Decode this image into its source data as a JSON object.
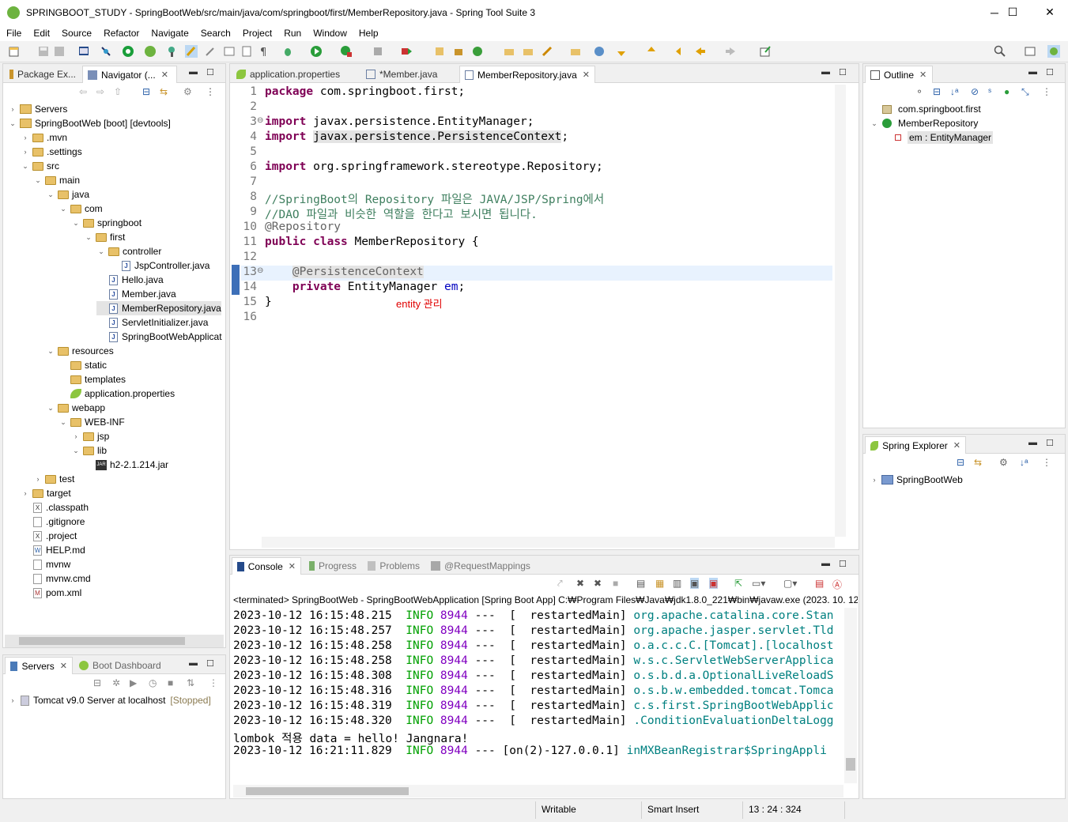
{
  "window": {
    "title": "SPRINGBOOT_STUDY - SpringBootWeb/src/main/java/com/springboot/first/MemberRepository.java - Spring Tool Suite 3",
    "controls": [
      "─",
      "☐",
      "✕"
    ]
  },
  "menu": [
    "File",
    "Edit",
    "Source",
    "Refactor",
    "Navigate",
    "Search",
    "Project",
    "Run",
    "Window",
    "Help"
  ],
  "left_panel": {
    "tabs": [
      {
        "label": "Package Ex..."
      },
      {
        "label": "Navigator (..."
      }
    ],
    "tree": [
      {
        "label": "Servers",
        "indent": 0,
        "twisty": "›",
        "icon": "project"
      },
      {
        "label": "SpringBootWeb [boot] [devtools]",
        "indent": 0,
        "twisty": "⌄",
        "icon": "project"
      },
      {
        "label": ".mvn",
        "indent": 1,
        "twisty": "›",
        "icon": "folder"
      },
      {
        "label": ".settings",
        "indent": 1,
        "twisty": "›",
        "icon": "folder"
      },
      {
        "label": "src",
        "indent": 1,
        "twisty": "⌄",
        "icon": "folder"
      },
      {
        "label": "main",
        "indent": 2,
        "twisty": "⌄",
        "icon": "folder"
      },
      {
        "label": "java",
        "indent": 3,
        "twisty": "⌄",
        "icon": "folder"
      },
      {
        "label": "com",
        "indent": 4,
        "twisty": "⌄",
        "icon": "folder"
      },
      {
        "label": "springboot",
        "indent": 5,
        "twisty": "⌄",
        "icon": "folder"
      },
      {
        "label": "first",
        "indent": 6,
        "twisty": "⌄",
        "icon": "folder"
      },
      {
        "label": "controller",
        "indent": 7,
        "twisty": "⌄",
        "icon": "folder"
      },
      {
        "label": "JspController.java",
        "indent": 8,
        "twisty": "",
        "icon": "java"
      },
      {
        "label": "Hello.java",
        "indent": 7,
        "twisty": "",
        "icon": "java"
      },
      {
        "label": "Member.java",
        "indent": 7,
        "twisty": "",
        "icon": "java"
      },
      {
        "label": "MemberRepository.java",
        "indent": 7,
        "twisty": "",
        "icon": "java",
        "selected": true
      },
      {
        "label": "ServletInitializer.java",
        "indent": 7,
        "twisty": "",
        "icon": "java"
      },
      {
        "label": "SpringBootWebApplicat",
        "indent": 7,
        "twisty": "",
        "icon": "java"
      },
      {
        "label": "resources",
        "indent": 3,
        "twisty": "⌄",
        "icon": "folder"
      },
      {
        "label": "static",
        "indent": 4,
        "twisty": "",
        "icon": "folder"
      },
      {
        "label": "templates",
        "indent": 4,
        "twisty": "",
        "icon": "folder"
      },
      {
        "label": "application.properties",
        "indent": 4,
        "twisty": "",
        "icon": "leaf"
      },
      {
        "label": "webapp",
        "indent": 3,
        "twisty": "⌄",
        "icon": "folder"
      },
      {
        "label": "WEB-INF",
        "indent": 4,
        "twisty": "⌄",
        "icon": "folder"
      },
      {
        "label": "jsp",
        "indent": 5,
        "twisty": "›",
        "icon": "folder"
      },
      {
        "label": "lib",
        "indent": 5,
        "twisty": "⌄",
        "icon": "folder"
      },
      {
        "label": "h2-2.1.214.jar",
        "indent": 6,
        "twisty": "",
        "icon": "jar"
      },
      {
        "label": "test",
        "indent": 2,
        "twisty": "›",
        "icon": "folder"
      },
      {
        "label": "target",
        "indent": 1,
        "twisty": "›",
        "icon": "folder"
      },
      {
        "label": ".classpath",
        "indent": 1,
        "twisty": "",
        "icon": "x"
      },
      {
        "label": ".gitignore",
        "indent": 1,
        "twisty": "",
        "icon": "file"
      },
      {
        "label": ".project",
        "indent": 1,
        "twisty": "",
        "icon": "x"
      },
      {
        "label": "HELP.md",
        "indent": 1,
        "twisty": "",
        "icon": "w"
      },
      {
        "label": "mvnw",
        "indent": 1,
        "twisty": "",
        "icon": "file"
      },
      {
        "label": "mvnw.cmd",
        "indent": 1,
        "twisty": "",
        "icon": "file"
      },
      {
        "label": "pom.xml",
        "indent": 1,
        "twisty": "",
        "icon": "m"
      }
    ]
  },
  "servers_panel": {
    "tabs": [
      {
        "label": "Servers"
      },
      {
        "label": "Boot Dashboard"
      }
    ],
    "server": "Tomcat v9.0 Server at localhost",
    "status": "[Stopped]"
  },
  "editor": {
    "tabs": [
      {
        "label": "application.properties"
      },
      {
        "label": "*Member.java"
      },
      {
        "label": "MemberRepository.java"
      }
    ],
    "lines": [
      {
        "n": "1",
        "parts": [
          {
            "t": "package",
            "c": "kw"
          },
          {
            "t": " com.springboot.first;",
            "c": ""
          }
        ]
      },
      {
        "n": "2",
        "parts": []
      },
      {
        "n": "3",
        "fold": true,
        "parts": [
          {
            "t": "import",
            "c": "kw"
          },
          {
            "t": " javax.persistence.EntityManager;",
            "c": ""
          }
        ]
      },
      {
        "n": "4",
        "parts": [
          {
            "t": "import",
            "c": "kw"
          },
          {
            "t": " ",
            "c": ""
          },
          {
            "t": "javax.persistence.PersistenceContext",
            "c": "hl"
          },
          {
            "t": ";",
            "c": ""
          }
        ]
      },
      {
        "n": "5",
        "parts": []
      },
      {
        "n": "6",
        "parts": [
          {
            "t": "import",
            "c": "kw"
          },
          {
            "t": " org.springframework.stereotype.Repository;",
            "c": ""
          }
        ]
      },
      {
        "n": "7",
        "parts": []
      },
      {
        "n": "8",
        "parts": [
          {
            "t": "//SpringBoot의 Repository 파일은 JAVA/JSP/Spring에서",
            "c": "cm"
          }
        ]
      },
      {
        "n": "9",
        "parts": [
          {
            "t": "//DAO 파일과 비슷한 역할을 한다고 보시면 됩니다.",
            "c": "cm"
          }
        ]
      },
      {
        "n": "10",
        "parts": [
          {
            "t": "@Repository",
            "c": "an"
          }
        ]
      },
      {
        "n": "11",
        "parts": [
          {
            "t": "public",
            "c": "kw"
          },
          {
            "t": " ",
            "c": ""
          },
          {
            "t": "class",
            "c": "kw"
          },
          {
            "t": " MemberRepository {",
            "c": ""
          }
        ]
      },
      {
        "n": "12",
        "parts": []
      },
      {
        "n": "13",
        "fold": true,
        "current": true,
        "parts": [
          {
            "t": "    ",
            "c": ""
          },
          {
            "t": "@PersistenceContext",
            "c": "an hl"
          }
        ]
      },
      {
        "n": "14",
        "parts": [
          {
            "t": "    ",
            "c": ""
          },
          {
            "t": "private",
            "c": "kw"
          },
          {
            "t": " EntityManager ",
            "c": ""
          },
          {
            "t": "em",
            "c": "fld"
          },
          {
            "t": ";",
            "c": ""
          }
        ]
      },
      {
        "n": "15",
        "parts": [
          {
            "t": "}",
            "c": ""
          }
        ]
      },
      {
        "n": "16",
        "parts": []
      }
    ],
    "annotation_note": "entity 관리"
  },
  "outline": {
    "tab": "Outline",
    "items": [
      {
        "label": "com.springboot.first",
        "indent": 0,
        "twisty": "",
        "icon": "package"
      },
      {
        "label": "MemberRepository",
        "indent": 0,
        "twisty": "⌄",
        "icon": "class"
      },
      {
        "label": "em : EntityManager",
        "indent": 1,
        "twisty": "",
        "icon": "field",
        "selected": true
      }
    ]
  },
  "spring_explorer": {
    "tab": "Spring Explorer",
    "items": [
      {
        "label": "SpringBootWeb"
      }
    ]
  },
  "console": {
    "tabs": [
      {
        "label": "Console"
      },
      {
        "label": "Progress"
      },
      {
        "label": "Problems"
      },
      {
        "label": "@RequestMappings"
      }
    ],
    "header": "<terminated> SpringBootWeb - SpringBootWebApplication [Spring Boot App] C:₩Program Files₩Java₩jdk1.8.0_221₩bin₩javaw.exe  (2023. 10. 12.",
    "lines": [
      {
        "ts": "2023-10-12 16:15:48.215",
        "lvl": "INFO",
        "pid": "8944",
        "thread": "---  [  restartedMain]",
        "logger": "org.apache.catalina.core.Stan"
      },
      {
        "ts": "2023-10-12 16:15:48.257",
        "lvl": "INFO",
        "pid": "8944",
        "thread": "---  [  restartedMain]",
        "logger": "org.apache.jasper.servlet.Tld"
      },
      {
        "ts": "2023-10-12 16:15:48.258",
        "lvl": "INFO",
        "pid": "8944",
        "thread": "---  [  restartedMain]",
        "logger": "o.a.c.c.C.[Tomcat].[localhost"
      },
      {
        "ts": "2023-10-12 16:15:48.258",
        "lvl": "INFO",
        "pid": "8944",
        "thread": "---  [  restartedMain]",
        "logger": "w.s.c.ServletWebServerApplica"
      },
      {
        "ts": "2023-10-12 16:15:48.308",
        "lvl": "INFO",
        "pid": "8944",
        "thread": "---  [  restartedMain]",
        "logger": "o.s.b.d.a.OptionalLiveReloadS"
      },
      {
        "ts": "2023-10-12 16:15:48.316",
        "lvl": "INFO",
        "pid": "8944",
        "thread": "---  [  restartedMain]",
        "logger": "o.s.b.w.embedded.tomcat.Tomca"
      },
      {
        "ts": "2023-10-12 16:15:48.319",
        "lvl": "INFO",
        "pid": "8944",
        "thread": "---  [  restartedMain]",
        "logger": "c.s.first.SpringBootWebApplic"
      },
      {
        "ts": "2023-10-12 16:15:48.320",
        "lvl": "INFO",
        "pid": "8944",
        "thread": "---  [  restartedMain]",
        "logger": ".ConditionEvaluationDeltaLogg"
      },
      {
        "plain": "lombok 적용 data = hello! Jangnara!"
      },
      {
        "ts": "2023-10-12 16:21:11.829",
        "lvl": "INFO",
        "pid": "8944",
        "thread": "--- [on(2)-127.0.0.1]",
        "logger": "inMXBeanRegistrar$SpringAppli"
      }
    ]
  },
  "statusbar": {
    "writable": "Writable",
    "insert_mode": "Smart Insert",
    "position": "13 : 24 : 324"
  },
  "colors": {
    "keyword": "#7f0055",
    "comment": "#3f7f5f",
    "annotation": "#646464",
    "info": "#00a000",
    "logger": "#008080",
    "note": "#e00000"
  }
}
